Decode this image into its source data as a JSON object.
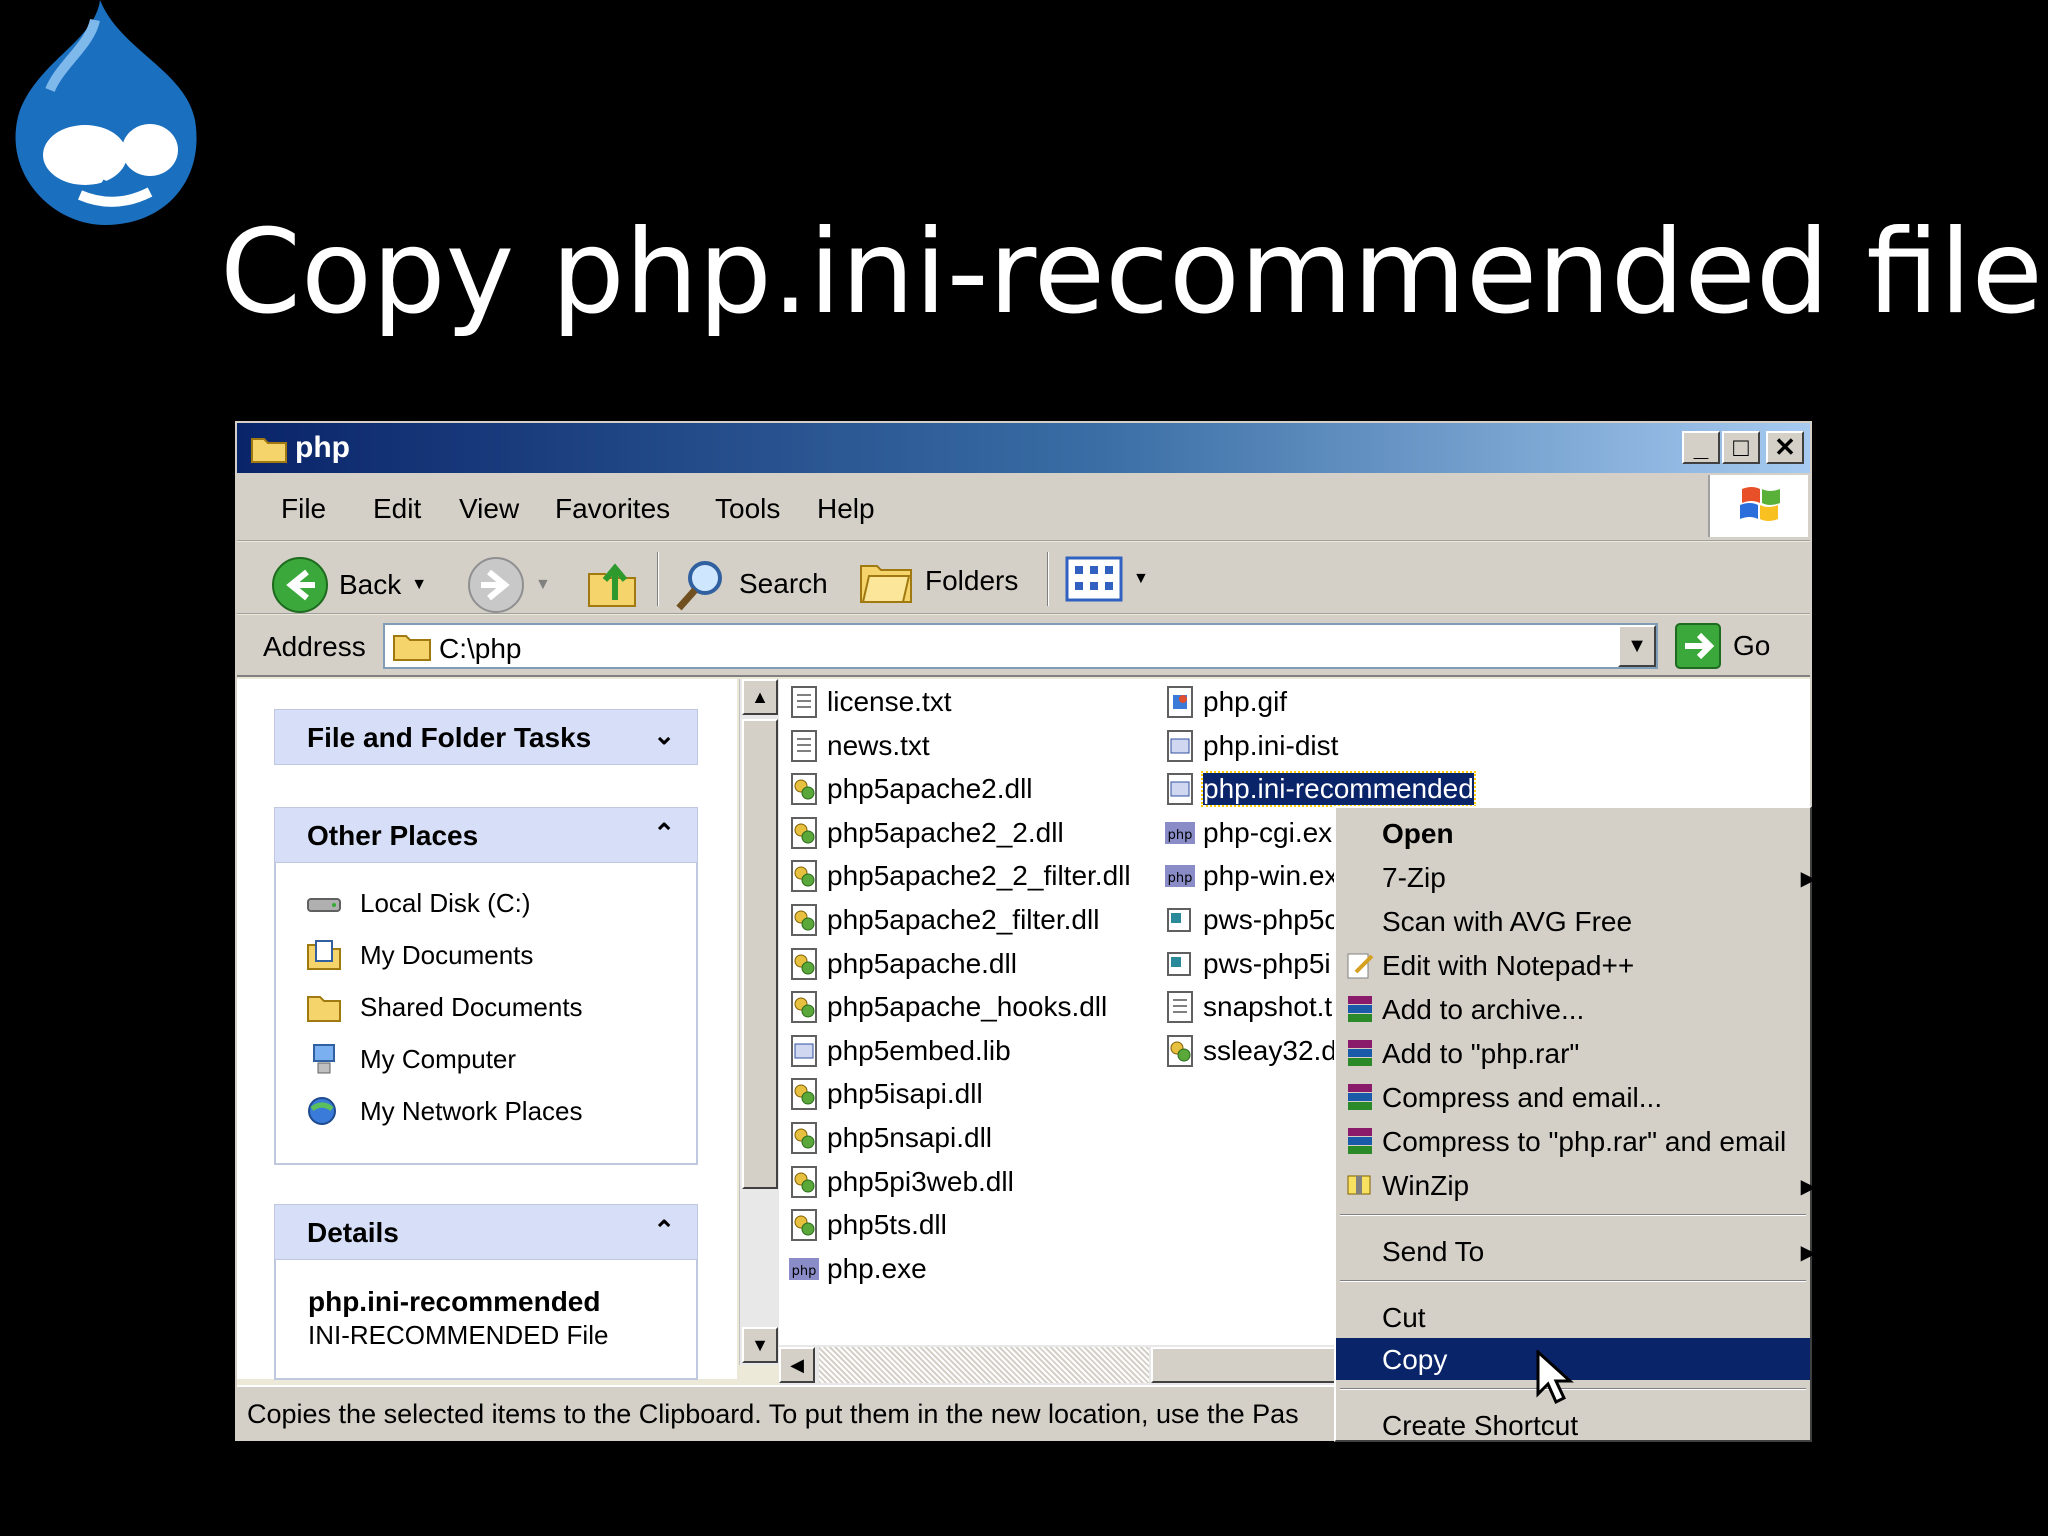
{
  "slide": {
    "title": "Copy php.ini-recommended file"
  },
  "window": {
    "title": "php",
    "menu": [
      "File",
      "Edit",
      "View",
      "Favorites",
      "Tools",
      "Help"
    ],
    "toolbar": {
      "back": "Back",
      "search": "Search",
      "folders": "Folders"
    },
    "address": {
      "label": "Address",
      "value": "C:\\php",
      "go": "Go"
    },
    "left_panel": {
      "tasks_header": "File and Folder Tasks",
      "other_header": "Other Places",
      "other_places": [
        "Local Disk (C:)",
        "My Documents",
        "Shared Documents",
        "My Computer",
        "My Network Places"
      ],
      "details_header": "Details",
      "details_name": "php.ini-recommended",
      "details_type": "INI-RECOMMENDED File"
    },
    "files_col1": [
      "license.txt",
      "news.txt",
      "php5apache2.dll",
      "php5apache2_2.dll",
      "php5apache2_2_filter.dll",
      "php5apache2_filter.dll",
      "php5apache.dll",
      "php5apache_hooks.dll",
      "php5embed.lib",
      "php5isapi.dll",
      "php5nsapi.dll",
      "php5pi3web.dll",
      "php5ts.dll",
      "php.exe"
    ],
    "files_col2": [
      "php.gif",
      "php.ini-dist",
      "php.ini-recommended",
      "php-cgi.ex",
      "php-win.ex",
      "pws-php5c",
      "pws-php5i",
      "snapshot.t",
      "ssleay32.d"
    ],
    "status": "Copies the selected items to the Clipboard. To put them in the new location, use the Pas"
  },
  "context_menu": {
    "items": [
      "Open",
      "7-Zip",
      "Scan with AVG Free",
      "Edit with Notepad++",
      "Add to archive...",
      "Add to \"php.rar\"",
      "Compress and email...",
      "Compress to \"php.rar\" and email",
      "WinZip"
    ],
    "send_to": "Send To",
    "cut": "Cut",
    "copy": "Copy",
    "create_shortcut": "Create Shortcut",
    "highlighted": "Copy"
  },
  "colors": {
    "title_blue": "#0a246a",
    "selection": "#0a246a",
    "panel_head": "#d6dff7",
    "chrome": "#d4d0c8"
  }
}
